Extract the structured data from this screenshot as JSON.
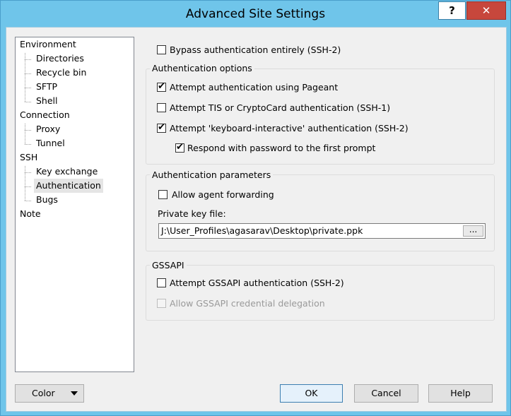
{
  "window": {
    "title": "Advanced Site Settings",
    "help_glyph": "?",
    "close_glyph": "✕"
  },
  "tree": {
    "items": [
      {
        "label": "Environment"
      },
      {
        "label": "Directories"
      },
      {
        "label": "Recycle bin"
      },
      {
        "label": "SFTP"
      },
      {
        "label": "Shell"
      },
      {
        "label": "Connection"
      },
      {
        "label": "Proxy"
      },
      {
        "label": "Tunnel"
      },
      {
        "label": "SSH"
      },
      {
        "label": "Key exchange"
      },
      {
        "label": "Authentication",
        "selected": true
      },
      {
        "label": "Bugs"
      },
      {
        "label": "Note"
      }
    ]
  },
  "bypass": {
    "label": "Bypass authentication entirely (SSH-2)",
    "checked": false
  },
  "auth_options": {
    "title": "Authentication options",
    "pageant": {
      "label": "Attempt authentication using Pageant",
      "checked": true
    },
    "tis": {
      "label": "Attempt TIS or CryptoCard authentication (SSH-1)",
      "checked": false
    },
    "kbd": {
      "label": "Attempt 'keyboard-interactive' authentication (SSH-2)",
      "checked": true
    },
    "respond": {
      "label": "Respond with password to the first prompt",
      "checked": true
    }
  },
  "auth_params": {
    "title": "Authentication parameters",
    "agent_forwarding": {
      "label": "Allow agent forwarding",
      "checked": false
    },
    "private_key_label": "Private key file:",
    "private_key_value": "J:\\User_Profiles\\agasarav\\Desktop\\private.ppk",
    "browse_label": "..."
  },
  "gssapi": {
    "title": "GSSAPI",
    "attempt": {
      "label": "Attempt GSSAPI authentication (SSH-2)",
      "checked": false
    },
    "delegation": {
      "label": "Allow GSSAPI credential delegation",
      "checked": false,
      "disabled": true
    }
  },
  "buttons": {
    "color": "Color",
    "ok": "OK",
    "cancel": "Cancel",
    "help": "Help"
  },
  "colors": {
    "frame": "#6fc5ea",
    "close": "#c7473c",
    "dialog": "#f0f0f0"
  }
}
